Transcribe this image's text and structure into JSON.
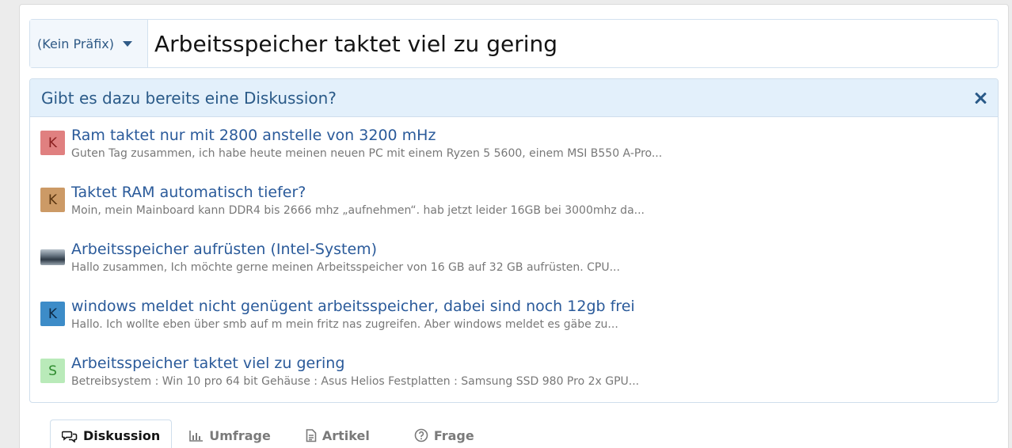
{
  "title_row": {
    "prefix_label": "(Kein Präfix)",
    "title_value": "Arbeitsspeicher taktet viel zu gering"
  },
  "similar": {
    "heading": "Gibt es dazu bereits eine Diskussion?",
    "threads": [
      {
        "avatar_letter": "K",
        "avatar_bg": "#e08080",
        "avatar_fg": "#8a1f1f",
        "title": "Ram taktet nur mit 2800 anstelle von 3200 mHz",
        "snippet": "Guten Tag zusammen, ich habe heute meinen neuen PC mit einem Ryzen 5 5600, einem MSI B550 A-Pro..."
      },
      {
        "avatar_letter": "K",
        "avatar_bg": "#cc9a66",
        "avatar_fg": "#5a3410",
        "title": "Taktet RAM automatisch tiefer?",
        "snippet": "Moin, mein Mainboard kann DDR4 bis 2666 mhz „aufnehmen“. hab jetzt leider 16GB bei 3000mhz da..."
      },
      {
        "avatar_letter": "",
        "avatar_bg": "photo",
        "avatar_fg": "",
        "title": "Arbeitsspeicher aufrüsten (Intel-System)",
        "snippet": "Hallo zusammen, Ich möchte gerne meinen Arbeitsspeicher von 16 GB auf 32 GB aufrüsten. CPU..."
      },
      {
        "avatar_letter": "K",
        "avatar_bg": "#3d8cc8",
        "avatar_fg": "#0e2a44",
        "title": "windows meldet nicht genügent arbeitsspeicher, dabei sind noch 12gb frei",
        "snippet": "Hallo. Ich wollte eben über smb auf m mein fritz nas zugreifen. Aber windows meldet es gäbe zu..."
      },
      {
        "avatar_letter": "S",
        "avatar_bg": "#b9eab9",
        "avatar_fg": "#2d8a2d",
        "title": "Arbeitsspeicher taktet viel zu gering",
        "snippet": "Betreibsystem : Win 10 pro 64 bit Gehäuse : Asus Helios Festplatten : Samsung SSD 980 Pro 2x GPU..."
      }
    ]
  },
  "tabs": [
    {
      "label": "Diskussion",
      "icon": "discussion-icon",
      "active": true
    },
    {
      "label": "Umfrage",
      "icon": "poll-chart-icon",
      "active": false
    },
    {
      "label": "Artikel",
      "icon": "article-doc-icon",
      "active": false
    },
    {
      "label": "Frage",
      "icon": "question-circle-icon",
      "active": false
    }
  ]
}
